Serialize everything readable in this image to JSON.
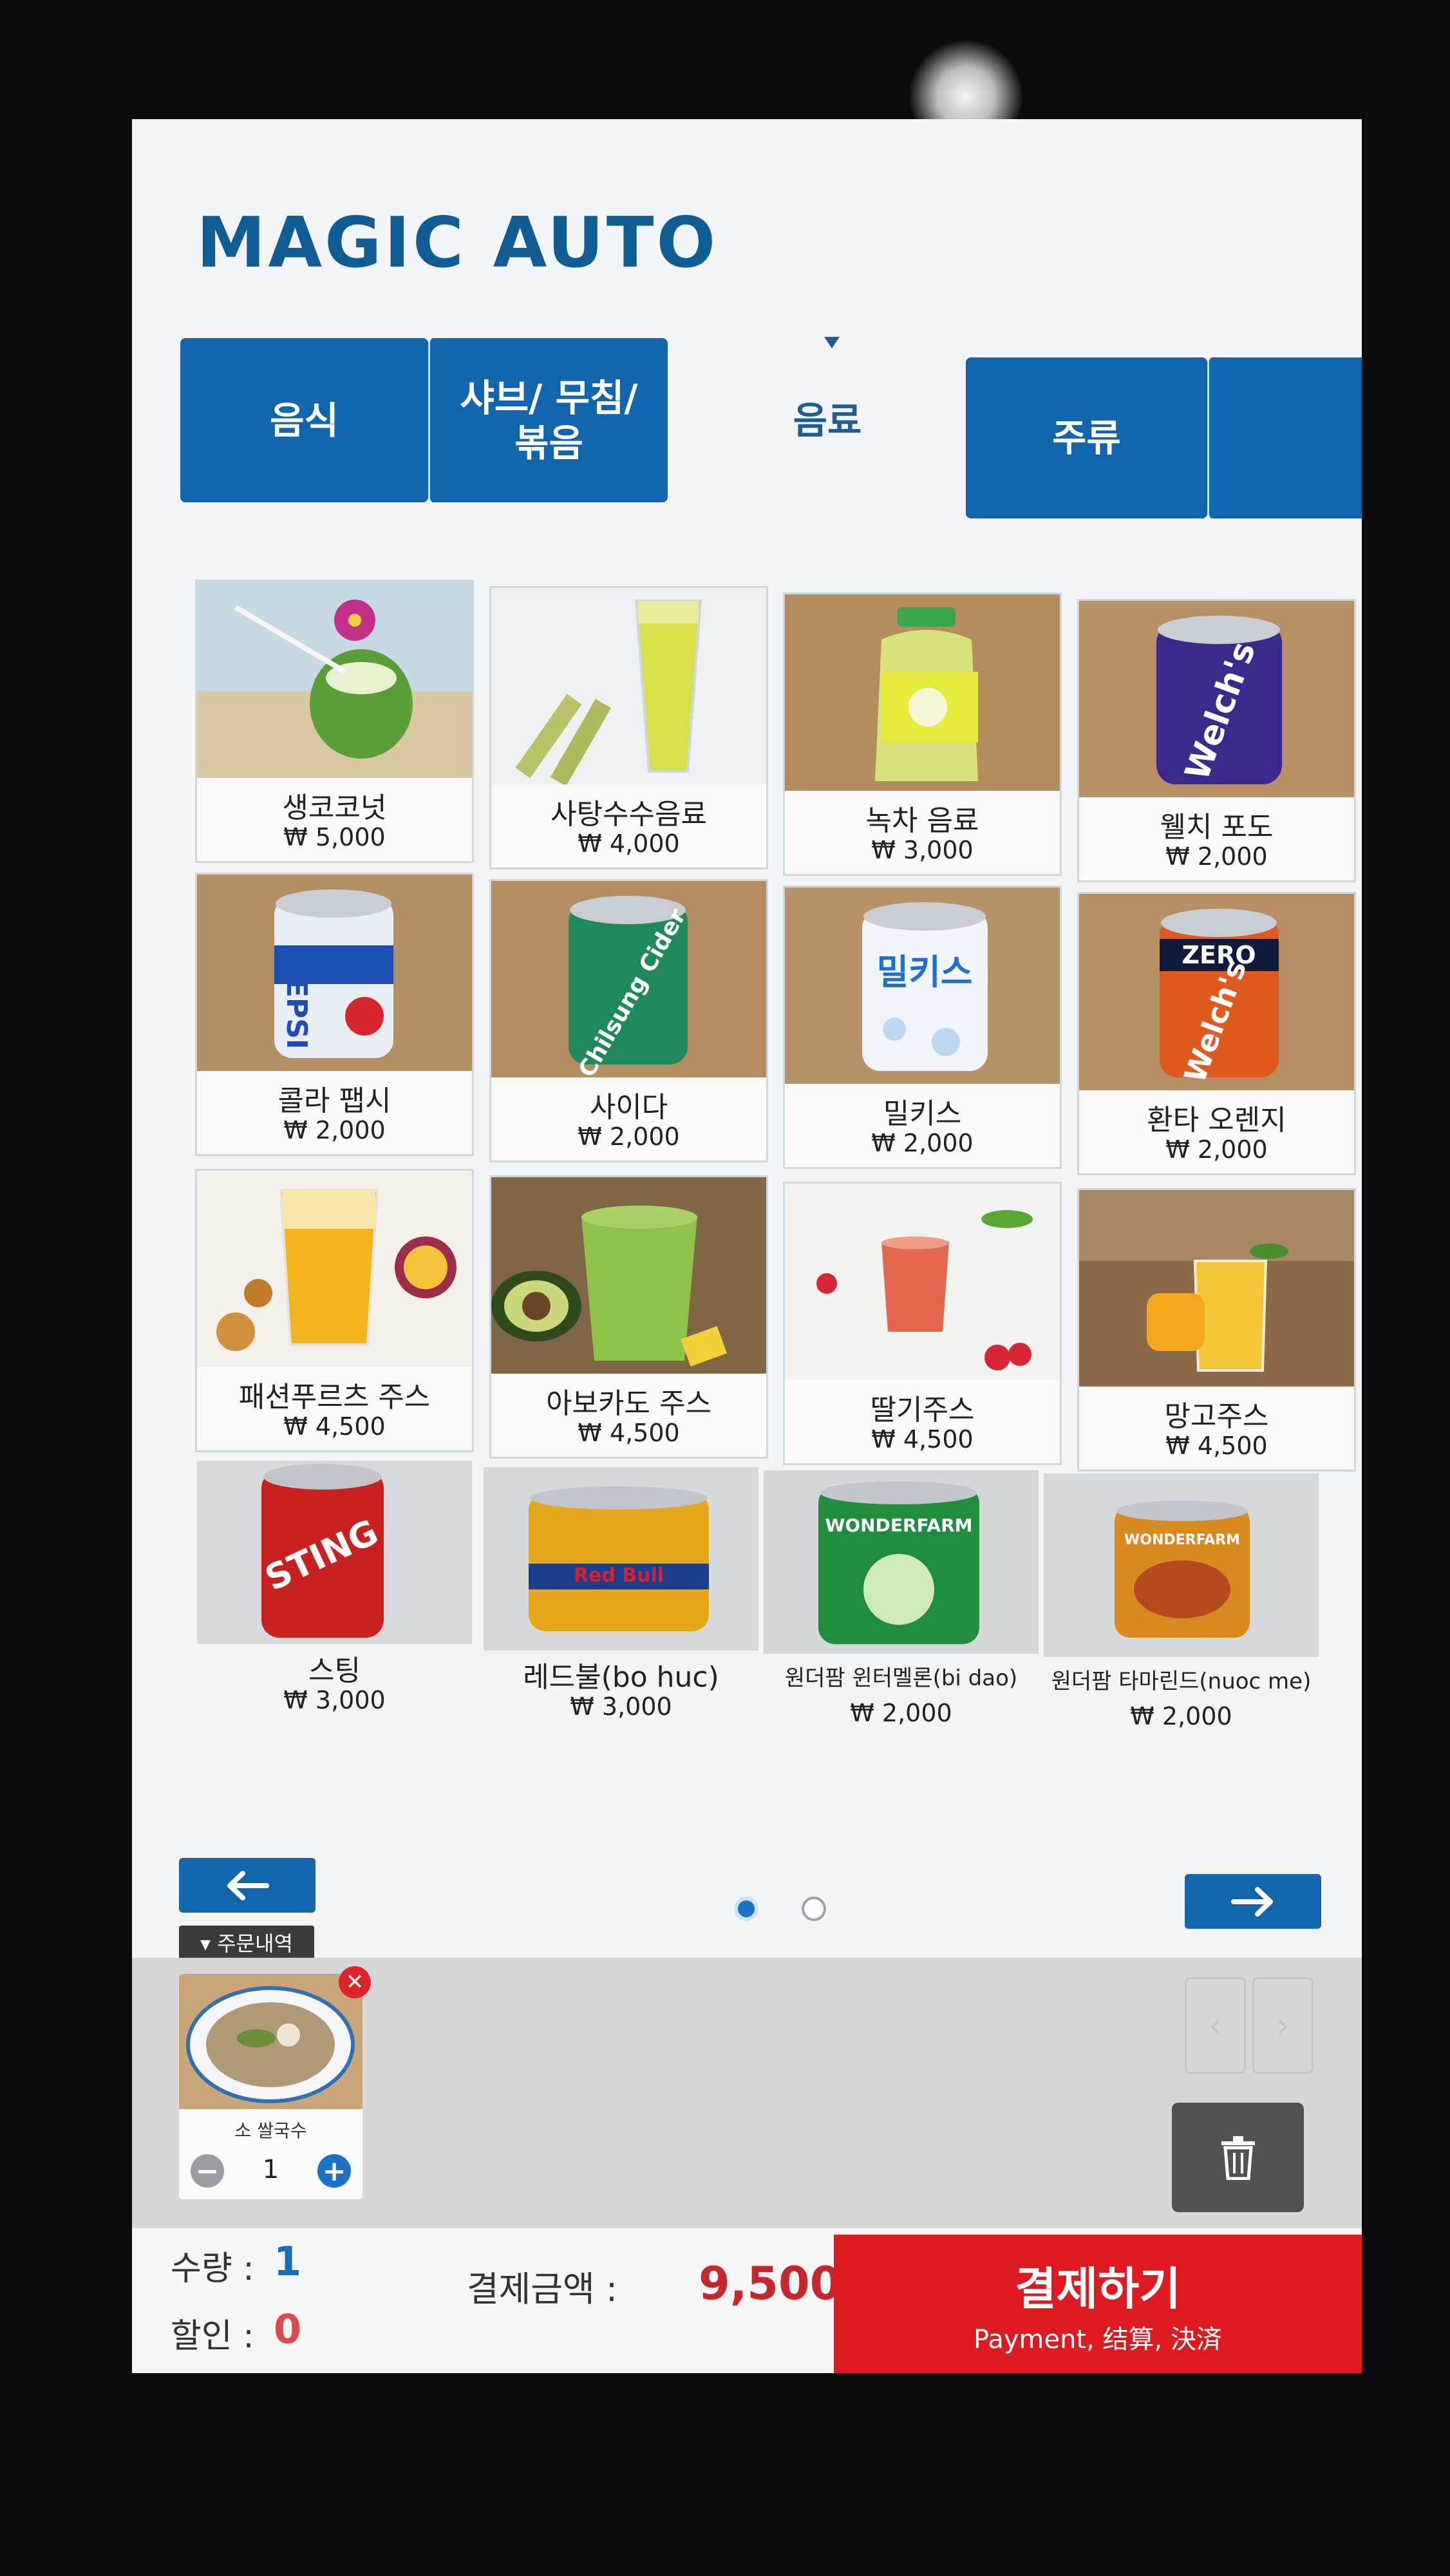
{
  "brand": {
    "logo": "MAGIC AUTO"
  },
  "tabs": [
    {
      "label": "음식"
    },
    {
      "label": "샤브/ 무침/ 볶음"
    },
    {
      "label": "음료"
    },
    {
      "label": "주류"
    },
    {
      "label": ""
    }
  ],
  "active_tab": "음료",
  "products": [
    {
      "name": "생코코넛",
      "price": "₩ 5,000"
    },
    {
      "name": "사탕수수음료",
      "price": "₩ 4,000"
    },
    {
      "name": "녹차 음료",
      "price": "₩ 3,000"
    },
    {
      "name": "웰치 포도",
      "price": "₩ 2,000"
    },
    {
      "name": "콜라 팹시",
      "price": "₩ 2,000"
    },
    {
      "name": "사이다",
      "price": "₩ 2,000"
    },
    {
      "name": "밀키스",
      "price": "₩ 2,000"
    },
    {
      "name": "환타 오렌지",
      "price": "₩ 2,000"
    },
    {
      "name": "패션푸르츠 주스",
      "price": "₩ 4,500"
    },
    {
      "name": "아보카도 주스",
      "price": "₩ 4,500"
    },
    {
      "name": "딸기주스",
      "price": "₩ 4,500"
    },
    {
      "name": "망고주스",
      "price": "₩ 4,500"
    },
    {
      "name": "스팅",
      "price": "₩ 3,000"
    },
    {
      "name": "레드불(bo huc)",
      "price": "₩ 3,000"
    },
    {
      "name": "원더팜 윈터멜론(bi dao)",
      "price": "₩ 2,000"
    },
    {
      "name": "원더팜 타마린드(nuoc me)",
      "price": "₩ 2,000"
    }
  ],
  "can_labels": {
    "pepsi": "PEPSI",
    "chilsung": "Chilsung Cider",
    "milkis": "밀키스",
    "welchs": "Welch's",
    "welchs_zero": "ZERO",
    "sting": "STING",
    "redbull": "Red Bull",
    "wonderfarm": "WONDERFARM"
  },
  "pagination": {
    "current": 1,
    "total": 2,
    "prev_icon": "arrow-left-icon",
    "next_icon": "arrow-right-icon"
  },
  "order": {
    "section_label": "▾ 주문내역",
    "items": [
      {
        "name": "소 쌀국수",
        "qty": "1"
      }
    ]
  },
  "summary": {
    "qty_label": "수량 :",
    "qty_value": "1",
    "discount_label": "할인 :",
    "discount_value": "0",
    "pay_label": "결제금액 :",
    "pay_amount": "9,500"
  },
  "checkout": {
    "label": "결제하기",
    "sublabel": "Payment, 结算, 決済"
  },
  "colors": {
    "primary": "#1065ad",
    "accent_red": "#dc1a20",
    "amount_red": "#c8262c"
  }
}
